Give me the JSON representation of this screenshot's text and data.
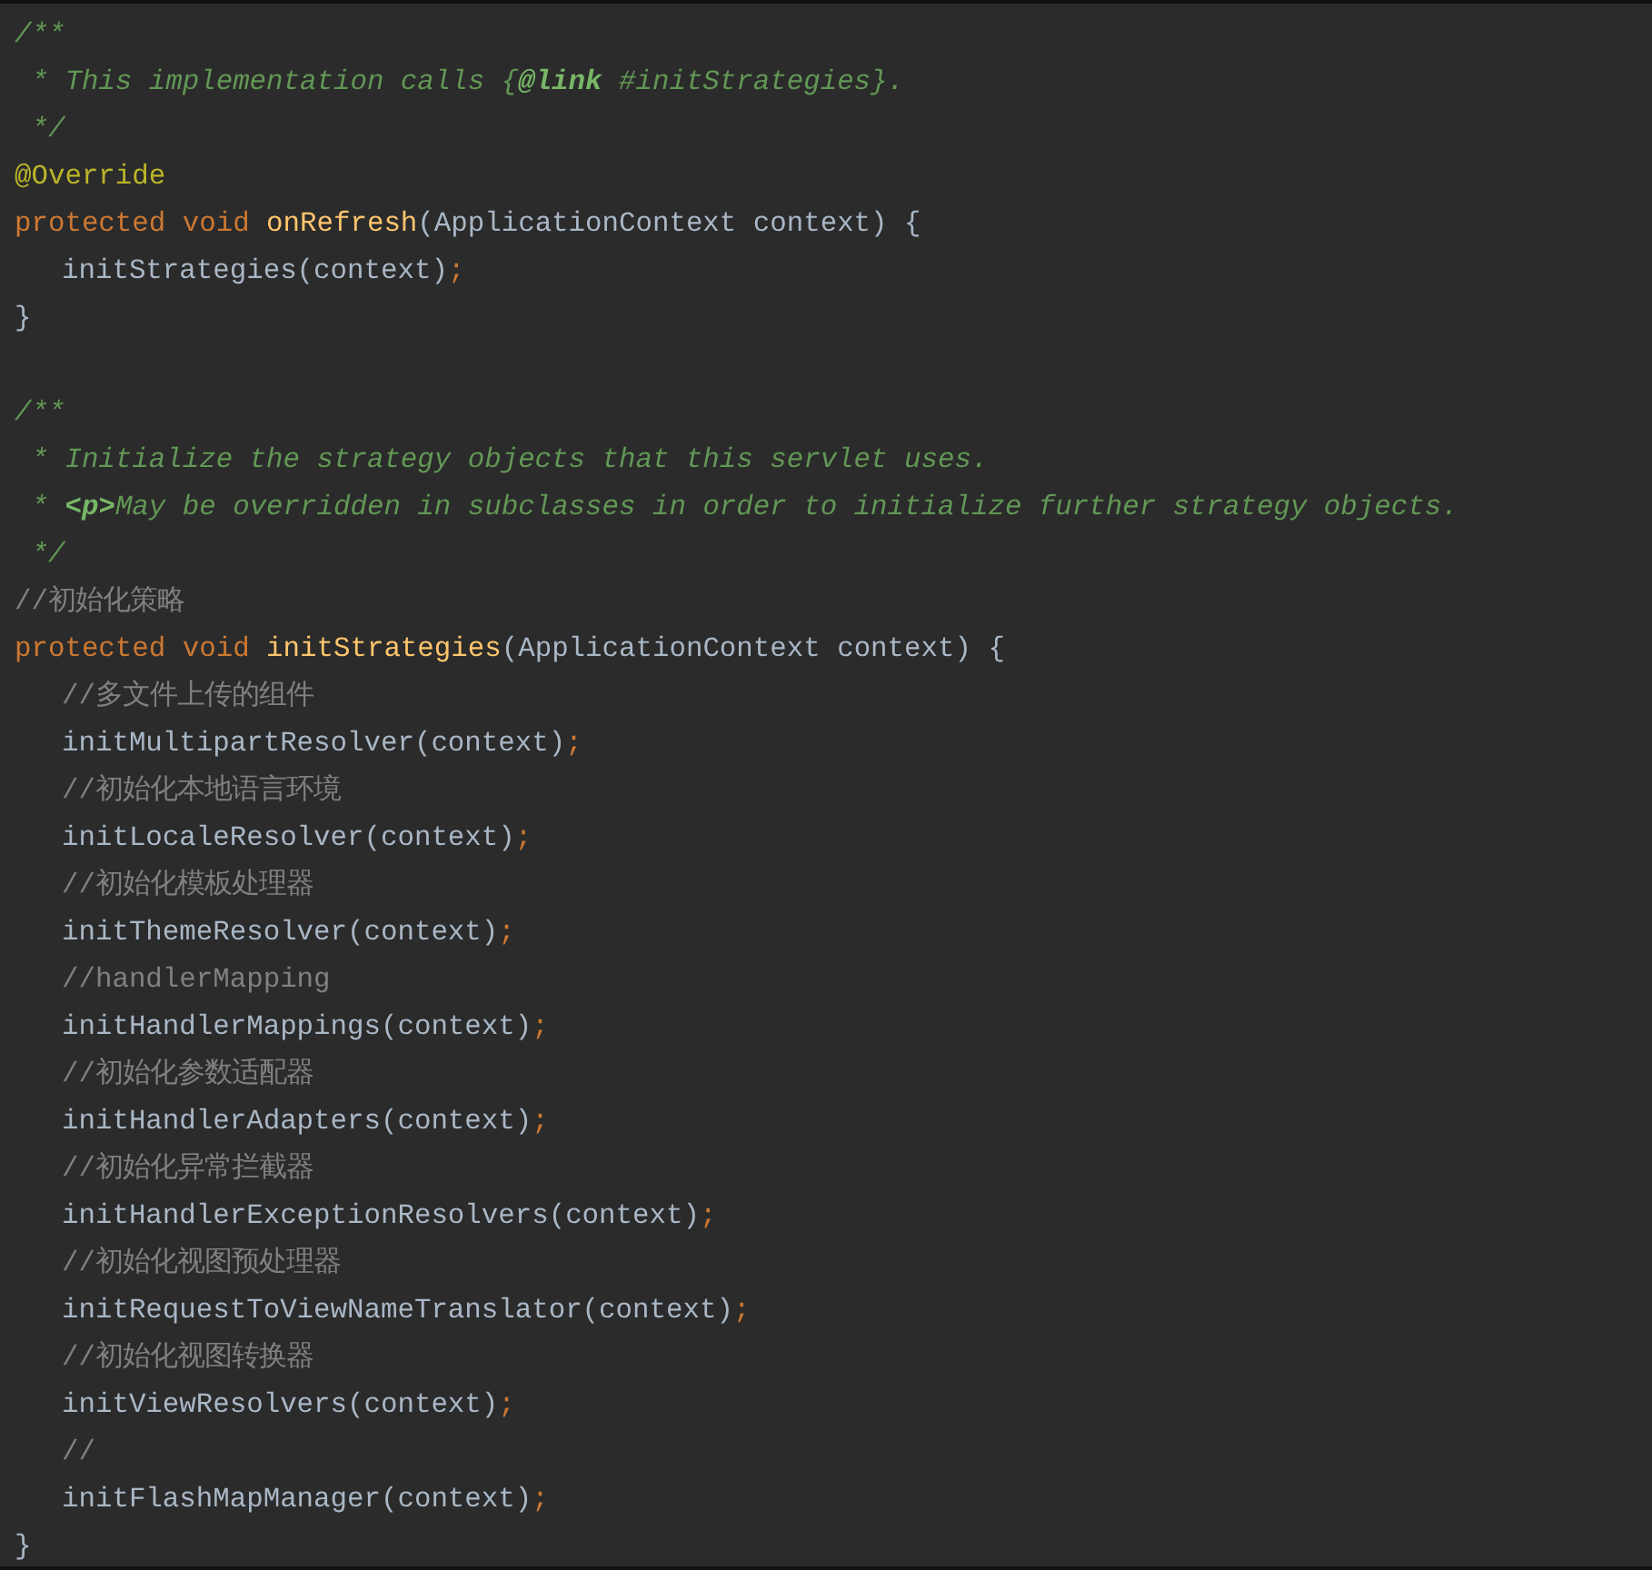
{
  "editor": {
    "lines": [
      {
        "kind": "code",
        "tokens": [
          {
            "kind": "doc",
            "text": "/**"
          }
        ]
      },
      {
        "kind": "code",
        "tokens": [
          {
            "kind": "doc",
            "text": " * This implementation calls {"
          },
          {
            "kind": "doc-tag",
            "text": "@link"
          },
          {
            "kind": "doc",
            "text": " #initStrategies}."
          }
        ]
      },
      {
        "kind": "code",
        "tokens": [
          {
            "kind": "doc",
            "text": " */"
          }
        ]
      },
      {
        "kind": "code",
        "tokens": [
          {
            "kind": "annotation",
            "text": "@Override"
          }
        ]
      },
      {
        "kind": "code",
        "tokens": [
          {
            "kind": "keyword",
            "text": "protected void "
          },
          {
            "kind": "method",
            "text": "onRefresh"
          },
          {
            "kind": "plain",
            "text": "(ApplicationContext context) {"
          }
        ],
        "children": [
          {
            "kind": "code",
            "tokens": [
              {
                "kind": "plain",
                "text": "initStrategies(context)"
              },
              {
                "kind": "punct",
                "text": ";"
              }
            ]
          }
        ]
      },
      {
        "kind": "code",
        "tokens": [
          {
            "kind": "plain",
            "text": "}"
          }
        ]
      },
      {
        "kind": "blank"
      },
      {
        "kind": "code",
        "tokens": [
          {
            "kind": "doc",
            "text": "/**"
          }
        ]
      },
      {
        "kind": "code",
        "tokens": [
          {
            "kind": "doc",
            "text": " * Initialize the strategy objects that this servlet uses."
          }
        ]
      },
      {
        "kind": "code",
        "tokens": [
          {
            "kind": "doc",
            "text": " * "
          },
          {
            "kind": "doc-tag",
            "text": "<p>"
          },
          {
            "kind": "doc",
            "text": "May be overridden in subclasses in order to initialize further strategy objects."
          }
        ]
      },
      {
        "kind": "code",
        "tokens": [
          {
            "kind": "doc",
            "text": " */"
          }
        ]
      },
      {
        "kind": "code",
        "tokens": [
          {
            "kind": "comment",
            "text": "//初始化策略"
          }
        ]
      },
      {
        "kind": "code",
        "tokens": [
          {
            "kind": "keyword",
            "text": "protected void "
          },
          {
            "kind": "method",
            "text": "initStrategies"
          },
          {
            "kind": "plain",
            "text": "(ApplicationContext context) {"
          }
        ],
        "children": [
          {
            "kind": "code",
            "tokens": [
              {
                "kind": "comment",
                "text": "//多文件上传的组件"
              }
            ]
          },
          {
            "kind": "code",
            "tokens": [
              {
                "kind": "plain",
                "text": "initMultipartResolver(context)"
              },
              {
                "kind": "punct",
                "text": ";"
              }
            ]
          },
          {
            "kind": "code",
            "tokens": [
              {
                "kind": "comment",
                "text": "//初始化本地语言环境"
              }
            ]
          },
          {
            "kind": "code",
            "tokens": [
              {
                "kind": "plain",
                "text": "initLocaleResolver(context)"
              },
              {
                "kind": "punct",
                "text": ";"
              }
            ]
          },
          {
            "kind": "code",
            "tokens": [
              {
                "kind": "comment",
                "text": "//初始化模板处理器"
              }
            ]
          },
          {
            "kind": "code",
            "tokens": [
              {
                "kind": "plain",
                "text": "initThemeResolver(context)"
              },
              {
                "kind": "punct",
                "text": ";"
              }
            ]
          },
          {
            "kind": "code",
            "tokens": [
              {
                "kind": "comment",
                "text": "//handlerMapping"
              }
            ]
          },
          {
            "kind": "code",
            "tokens": [
              {
                "kind": "plain",
                "text": "initHandlerMappings(context)"
              },
              {
                "kind": "punct",
                "text": ";"
              }
            ]
          },
          {
            "kind": "code",
            "tokens": [
              {
                "kind": "comment",
                "text": "//初始化参数适配器"
              }
            ]
          },
          {
            "kind": "code",
            "tokens": [
              {
                "kind": "plain",
                "text": "initHandlerAdapters(context)"
              },
              {
                "kind": "punct",
                "text": ";"
              }
            ]
          },
          {
            "kind": "code",
            "tokens": [
              {
                "kind": "comment",
                "text": "//初始化异常拦截器"
              }
            ]
          },
          {
            "kind": "code",
            "tokens": [
              {
                "kind": "plain",
                "text": "initHandlerExceptionResolvers(context)"
              },
              {
                "kind": "punct",
                "text": ";"
              }
            ]
          },
          {
            "kind": "code",
            "tokens": [
              {
                "kind": "comment",
                "text": "//初始化视图预处理器"
              }
            ]
          },
          {
            "kind": "code",
            "tokens": [
              {
                "kind": "plain",
                "text": "initRequestToViewNameTranslator(context)"
              },
              {
                "kind": "punct",
                "text": ";"
              }
            ]
          },
          {
            "kind": "code",
            "tokens": [
              {
                "kind": "comment",
                "text": "//初始化视图转换器"
              }
            ]
          },
          {
            "kind": "code",
            "tokens": [
              {
                "kind": "plain",
                "text": "initViewResolvers(context)"
              },
              {
                "kind": "punct",
                "text": ";"
              }
            ]
          },
          {
            "kind": "code",
            "tokens": [
              {
                "kind": "comment",
                "text": "//"
              }
            ]
          },
          {
            "kind": "code",
            "tokens": [
              {
                "kind": "plain",
                "text": "initFlashMapManager(context)"
              },
              {
                "kind": "punct",
                "text": ";"
              }
            ]
          }
        ]
      },
      {
        "kind": "code",
        "tokens": [
          {
            "kind": "plain",
            "text": "}"
          }
        ]
      }
    ]
  }
}
